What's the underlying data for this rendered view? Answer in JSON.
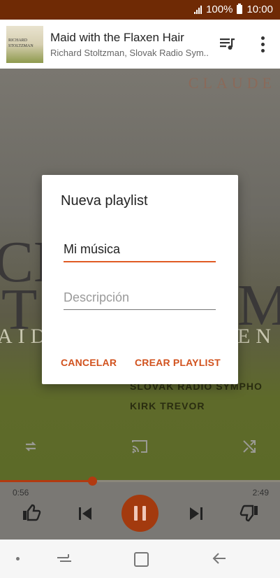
{
  "status_bar": {
    "battery": "100%",
    "time": "10:00"
  },
  "now_playing": {
    "title": "Maid with the Flaxen Hair",
    "artist": "Richard Stoltzman, Slovak Radio Sym..",
    "album_thumb_lines": [
      "RICHARD",
      "STOLTZMAN"
    ]
  },
  "album_art": {
    "word_claude": "CLAUDE",
    "big_left_1": "CH",
    "big_left_2": "T",
    "big_right": "M",
    "band_left": "AID",
    "band_right": "EN",
    "line1": "SLOVAK RADIO SYMPHO",
    "line2": "KIRK TREVOR"
  },
  "player": {
    "elapsed": "0:56",
    "duration": "2:49",
    "progress_fraction": 0.33
  },
  "dialog": {
    "title": "Nueva playlist",
    "name_value": "Mi música",
    "description_placeholder": "Descripción",
    "cancel_label": "CANCELAR",
    "create_label": "CREAR PLAYLIST"
  },
  "colors": {
    "accent": "#e05a24",
    "status_bar": "#6f2a05"
  }
}
